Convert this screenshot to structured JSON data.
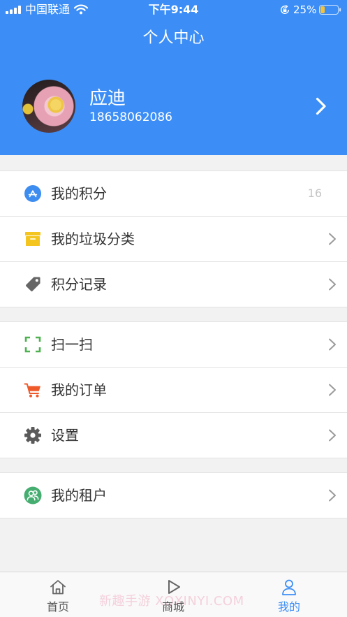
{
  "status_bar": {
    "carrier": "中国联通",
    "time": "下午9:44",
    "battery_text": "25%",
    "battery_level": 0.25
  },
  "header": {
    "title": "个人中心"
  },
  "profile": {
    "name": "应迪",
    "phone": "18658062086"
  },
  "menu": {
    "sections": [
      {
        "items": [
          {
            "label": "我的积分",
            "value": "16",
            "icon": "app-store-icon"
          },
          {
            "label": "我的垃圾分类",
            "icon": "archive-box-icon"
          },
          {
            "label": "积分记录",
            "icon": "tag-icon"
          }
        ]
      },
      {
        "items": [
          {
            "label": "扫一扫",
            "icon": "scan-icon"
          },
          {
            "label": "我的订单",
            "icon": "cart-icon"
          },
          {
            "label": "设置",
            "icon": "gear-icon"
          }
        ]
      },
      {
        "items": [
          {
            "label": "我的租户",
            "icon": "users-icon"
          }
        ]
      }
    ]
  },
  "tabs": [
    {
      "label": "首页",
      "icon": "home-icon",
      "active": false
    },
    {
      "label": "商城",
      "icon": "play-icon",
      "active": false
    },
    {
      "label": "我的",
      "icon": "user-icon",
      "active": true
    }
  ],
  "watermark": "新趣手游 XQXINYI.COM",
  "colors": {
    "brand": "#3c8ef6",
    "page_bg": "#f2f2f2",
    "text": "#333333",
    "muted": "#c4c4c4",
    "chevron": "#9b9b9b",
    "divider": "#e2e2e2",
    "points_icon": "#3d8cf0",
    "archive_icon": "#f4c51f",
    "tag_icon": "#666666",
    "scan_icon": "#4cb14e",
    "cart_icon": "#ef5a2b",
    "gear_icon": "#5a5a5a",
    "tenant_icon": "#45ad70",
    "battery_fill": "#f6c23a",
    "tab_inactive": "#666666",
    "watermark": "#f0a0b8"
  }
}
